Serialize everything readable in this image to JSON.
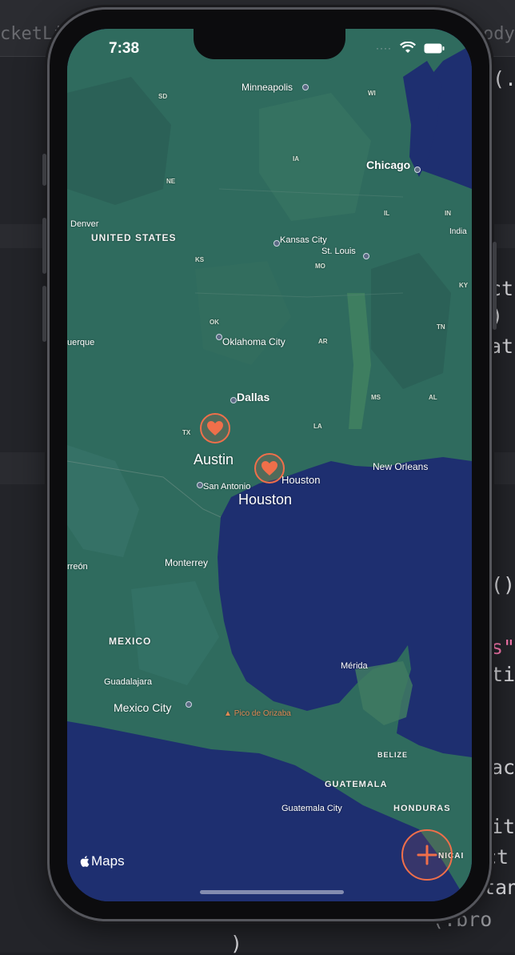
{
  "editor": {
    "tabs": [
      "cketLis",
      "ody"
    ],
    "code_fragments": [
      "(.",
      "ct",
      ")",
      "at",
      "()",
      "s\"",
      "ti",
      "ac",
      "it",
      "ct",
      "tan",
      "(.bro",
      ")"
    ]
  },
  "status_bar": {
    "time": "7:38",
    "icons": [
      "signal-icon",
      "wifi-icon",
      "battery-icon"
    ]
  },
  "map": {
    "cities": {
      "minneapolis": "Minneapolis",
      "chicago": "Chicago",
      "denver": "Denver",
      "kansas_city": "Kansas City",
      "st_louis": "St. Louis",
      "oklahoma_city": "Oklahoma City",
      "albuquerque": "uerque",
      "dallas": "Dallas",
      "san_antonio": "San Antonio",
      "houston_small": "Houston",
      "new_orleans": "New Orleans",
      "monterrey": "Monterrey",
      "torreon": "rreón",
      "guadalajara": "Guadalajara",
      "mexico_city": "Mexico City",
      "merida": "Mérida",
      "guatemala_city": "Guatemala City",
      "indianapolis": "India"
    },
    "countries": {
      "us": "UNITED STATES",
      "mexico": "MEXICO",
      "guatemala": "GUATEMALA",
      "belize": "BELIZE",
      "honduras": "HONDURAS",
      "nicaragua": "NICAI"
    },
    "states": {
      "sd": "SD",
      "wi": "WI",
      "ne": "NE",
      "ia": "IA",
      "il": "IL",
      "in": "IN",
      "ks": "KS",
      "mo": "MO",
      "ky": "KY",
      "ok": "OK",
      "ar": "AR",
      "tn": "TN",
      "tx": "TX",
      "la": "LA",
      "ms": "MS",
      "al": "AL"
    },
    "landmark": "Pico de Orizaba",
    "pins": [
      {
        "label": "Austin",
        "icon": "heart-icon"
      },
      {
        "label": "Houston",
        "icon": "heart-icon"
      }
    ],
    "colors": {
      "ocean": "#1e2f70",
      "land": "#2f6b5e",
      "accent": "#f06f4a"
    }
  },
  "attribution": "Maps",
  "add_button_icon": "plus-icon"
}
